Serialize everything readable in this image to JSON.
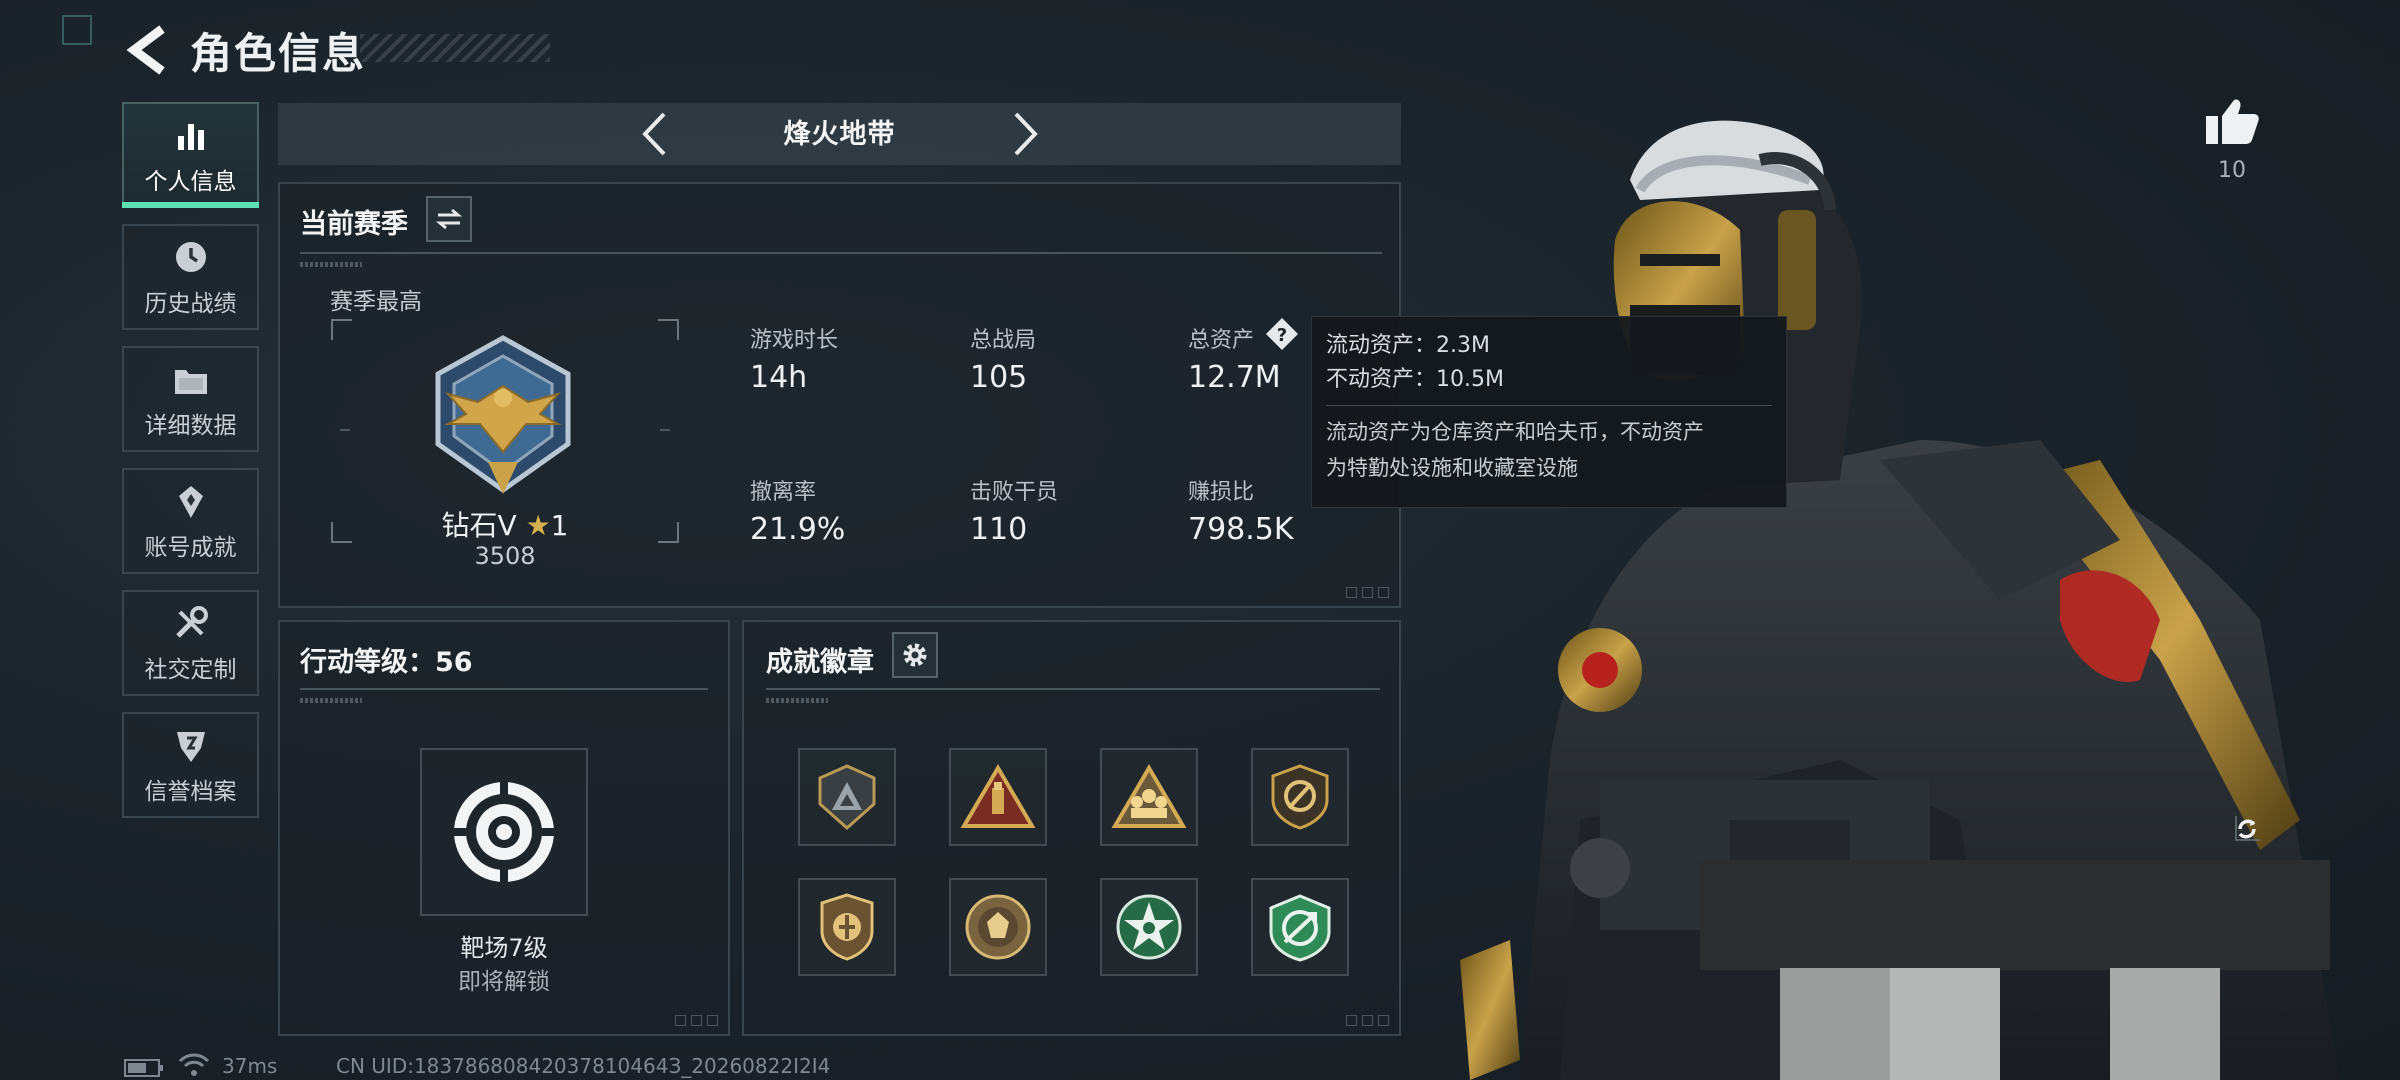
{
  "header": {
    "title": "角色信息"
  },
  "sidebar": {
    "items": [
      {
        "label": "个人信息",
        "icon": "bar-chart-icon",
        "active": true
      },
      {
        "label": "历史战绩",
        "icon": "history-icon"
      },
      {
        "label": "详细数据",
        "icon": "folder-icon"
      },
      {
        "label": "账号成就",
        "icon": "achievement-icon"
      },
      {
        "label": "社交定制",
        "icon": "tools-icon"
      },
      {
        "label": "信誉档案",
        "icon": "credit-icon"
      }
    ]
  },
  "mode": {
    "title": "烽火地带"
  },
  "season": {
    "title": "当前赛季",
    "best_label": "赛季最高",
    "rank_name": "钻石V",
    "rank_stars": "1",
    "rank_score": "3508",
    "stats": [
      {
        "label": "游戏时长",
        "value": "14h"
      },
      {
        "label": "总战局",
        "value": "105"
      },
      {
        "label": "总资产",
        "value": "12.7M"
      },
      {
        "label": "撤离率",
        "value": "21.9%"
      },
      {
        "label": "击败干员",
        "value": "110"
      },
      {
        "label": "赚损比",
        "value": "798.5K"
      }
    ]
  },
  "tooltip": {
    "liquid": "流动资产：2.3M",
    "fixed": "不动资产：10.5M",
    "desc_line1": "流动资产为仓库资产和哈夫币，不动资产",
    "desc_line2": "为特勤处设施和收藏室设施"
  },
  "action_level": {
    "title": "行动等级：56",
    "reward_name": "靶场7级",
    "reward_status": "即将解锁"
  },
  "achievements": {
    "title": "成就徽章",
    "badges": [
      "badge-triangle-shield-icon",
      "badge-warning-triangle-icon",
      "badge-squad-triangle-icon",
      "badge-shield-ring-icon",
      "badge-crest-icon",
      "badge-medallion-icon",
      "badge-green-star-icon",
      "badge-green-arrow-icon"
    ]
  },
  "likes": {
    "count": "10"
  },
  "footer": {
    "ping": "37ms",
    "uid": "CN UID:18378680842037810464З_20260822I2I4"
  },
  "colors": {
    "accent": "#5de0b4",
    "gold": "#c9a24a",
    "green_badge": "#2e8b57"
  }
}
